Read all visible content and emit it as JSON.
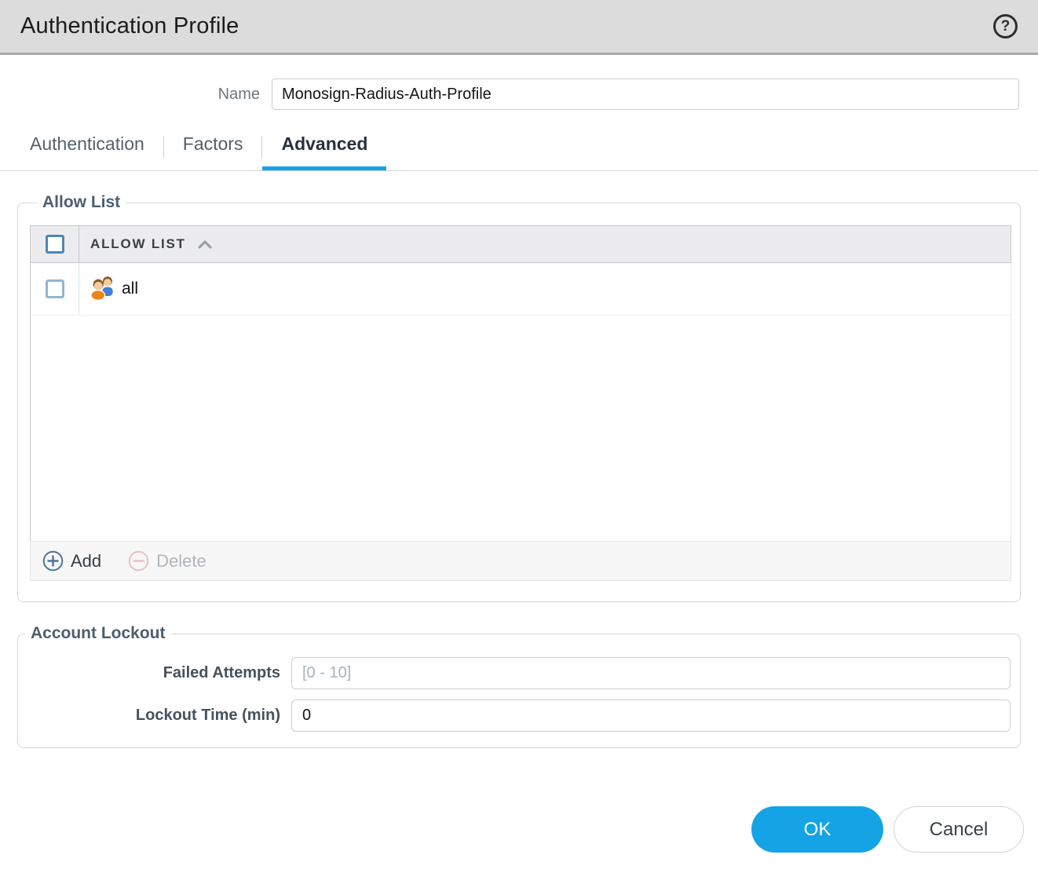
{
  "colors": {
    "accent_blue": "#14a4e6",
    "header_gray": "#dcdcdc",
    "legend_slate": "#4c5e6e"
  },
  "header": {
    "title": "Authentication Profile",
    "help_icon": "question-mark-circle"
  },
  "name_field": {
    "label": "Name",
    "value": "Monosign-Radius-Auth-Profile"
  },
  "tabs": {
    "items": [
      {
        "label": "Authentication",
        "active": false
      },
      {
        "label": "Factors",
        "active": false
      },
      {
        "label": "Advanced",
        "active": true
      }
    ]
  },
  "allow_list": {
    "legend": "Allow List",
    "table": {
      "column_header": "ALLOW LIST",
      "sort_direction": "ascending",
      "rows": [
        {
          "icon": "users-icon",
          "label": "all",
          "checked": false
        }
      ]
    },
    "actions": {
      "add_label": "Add",
      "delete_label": "Delete",
      "delete_disabled": true
    }
  },
  "account_lockout": {
    "legend": "Account Lockout",
    "failed_attempts": {
      "label": "Failed Attempts",
      "placeholder": "[0 - 10]",
      "value": ""
    },
    "lockout_time": {
      "label": "Lockout Time (min)",
      "value": "0"
    }
  },
  "dialog_actions": {
    "ok_label": "OK",
    "cancel_label": "Cancel"
  }
}
